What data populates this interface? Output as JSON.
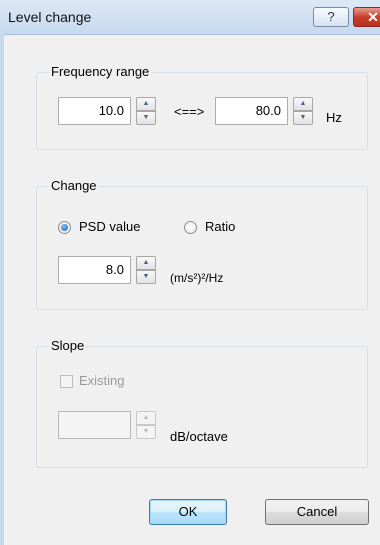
{
  "window": {
    "title": "Level change",
    "help_label": "?",
    "close_label": "✕"
  },
  "frequency": {
    "legend": "Frequency range",
    "from_value": "10.0",
    "separator": "<==>",
    "to_value": "80.0",
    "unit": "Hz"
  },
  "change": {
    "legend": "Change",
    "options": [
      "PSD value",
      "Ratio"
    ],
    "selected": "PSD value",
    "value": "8.0",
    "unit": "(m/s²)²/Hz"
  },
  "slope": {
    "legend": "Slope",
    "existing_label": "Existing",
    "existing_checked": false,
    "value": "",
    "unit": "dB/octave"
  },
  "buttons": {
    "ok_label": "OK",
    "cancel_label": "Cancel"
  },
  "icons": {
    "spin_up": "▲",
    "spin_down": "▼"
  }
}
